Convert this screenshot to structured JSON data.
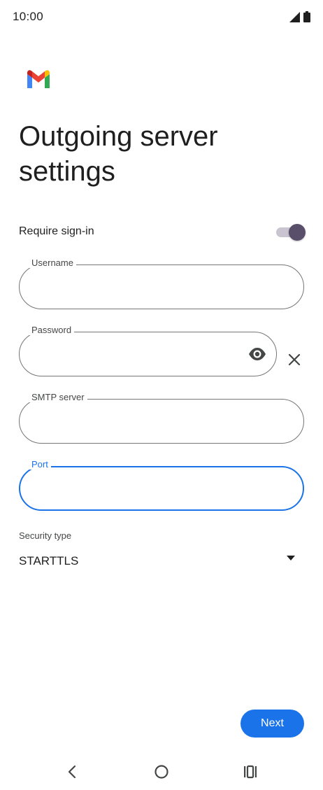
{
  "status_bar": {
    "time": "10:00",
    "icons": [
      "signal-icon",
      "battery-icon"
    ]
  },
  "app": {
    "logo": "gmail-logo-icon"
  },
  "page": {
    "title": "Outgoing server settings"
  },
  "require_signin": {
    "label": "Require sign-in",
    "enabled": true
  },
  "fields": {
    "username": {
      "label": "Username",
      "value": ""
    },
    "password": {
      "label": "Password",
      "value": ""
    },
    "smtp_server": {
      "label": "SMTP server",
      "value": ""
    },
    "port": {
      "label": "Port",
      "value": ""
    }
  },
  "security": {
    "label": "Security type",
    "value": "STARTTLS"
  },
  "actions": {
    "next_label": "Next"
  },
  "navigation": {
    "buttons": [
      "back-icon",
      "home-icon",
      "recent-apps-icon"
    ]
  },
  "colors": {
    "accent": "#1a73e8",
    "toggle_thumb": "#5a4f6b",
    "toggle_track": "#c9c4d0",
    "outline": "#747775"
  }
}
